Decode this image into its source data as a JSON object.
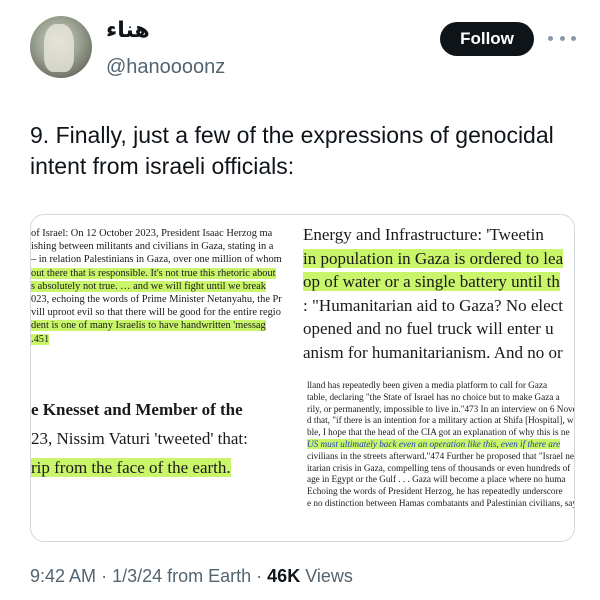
{
  "user": {
    "display_name": "هناء",
    "handle": "@hanoooonz",
    "avatar_icon": "profile-photo"
  },
  "follow_label": "Follow",
  "tweet_text": "9. Finally, just a few of the expressions of genocidal intent from israeli officials:",
  "media": {
    "clip1": [
      {
        "text": "of Israel: On 12 October 2023, President Isaac Herzog ma",
        "style": "plain"
      },
      {
        "text": "ishing between militants and civilians in Gaza, stating in a",
        "style": "plain"
      },
      {
        "text": "– in relation Palestinians in Gaza, over one million of whom",
        "style": "plain"
      },
      {
        "text": "out there that is responsible. It's not true this rhetoric about",
        "style": "hl"
      },
      {
        "text": "s absolutely not true. … and we will fight until we break",
        "style": "hl"
      },
      {
        "text": "023, echoing the words of Prime Minister Netanyahu, the Pr",
        "style": "plain"
      },
      {
        "text": "vill uproot evil so that there will be good for the entire regio",
        "style": "plain"
      },
      {
        "text": "dent is one of many Israelis to have handwritten 'messag",
        "style": "hl"
      },
      {
        "text": ".451",
        "style": "hl"
      }
    ],
    "clip2": [
      {
        "text": "Energy and Infrastructure: 'Tweetin",
        "style": "plain"
      },
      {
        "text": "in population in Gaza is ordered to lea",
        "style": "hl"
      },
      {
        "text": "op of water or a single battery until th",
        "style": "hl"
      },
      {
        "text": ": \"Humanitarian aid to Gaza? No elect",
        "style": "plain"
      },
      {
        "text": "opened and no fuel truck will enter u",
        "style": "plain"
      },
      {
        "text": "anism for humanitarianism. And no or",
        "style": "plain"
      }
    ],
    "clip3": [
      {
        "text": "e Knesset and Member of the",
        "style": "bold"
      },
      {
        "text": "23, Nissim Vaturi 'tweeted' that:",
        "style": "plain"
      },
      {
        "text": "rip from the face of the earth.",
        "style": "hl"
      }
    ],
    "clip4": [
      {
        "text": "lland has repeatedly been given a media platform to call for Gaza",
        "style": "plain"
      },
      {
        "text": "table, declaring \"the State of Israel has no choice but to make Gaza a",
        "style": "plain"
      },
      {
        "text": "rily, or permanently, impossible to live in.\"473 In an interview on 6 Novem",
        "style": "plain"
      },
      {
        "text": "d that, \"if there is an intention for a military action at Shifa [Hospital], wh",
        "style": "plain"
      },
      {
        "text": "ble, I hope that the head of the CIA got an explanation of why this is ne",
        "style": "plain"
      },
      {
        "text": "US must ultimately back even an operation like this, even if there are",
        "style": "hl-i"
      },
      {
        "text": "civilians in the streets afterward.\"474 Further he proposed that \"Israel ne",
        "style": "plain"
      },
      {
        "text": "itarian crisis in Gaza, compelling tens of thousands or even hundreds of",
        "style": "plain"
      },
      {
        "text": "age in Egypt or the Gulf . . . Gaza will become a place where no huma",
        "style": "plain"
      },
      {
        "text": "Echoing the words of President Herzog, he has repeatedly underscore",
        "style": "plain"
      },
      {
        "text": "e no distinction between Hamas combatants and Palestinian civilians, say",
        "style": "plain"
      }
    ]
  },
  "meta": {
    "time": "9:42 AM",
    "date": "1/3/24",
    "source": "from Earth",
    "views_count": "46K",
    "views_label": "Views"
  }
}
